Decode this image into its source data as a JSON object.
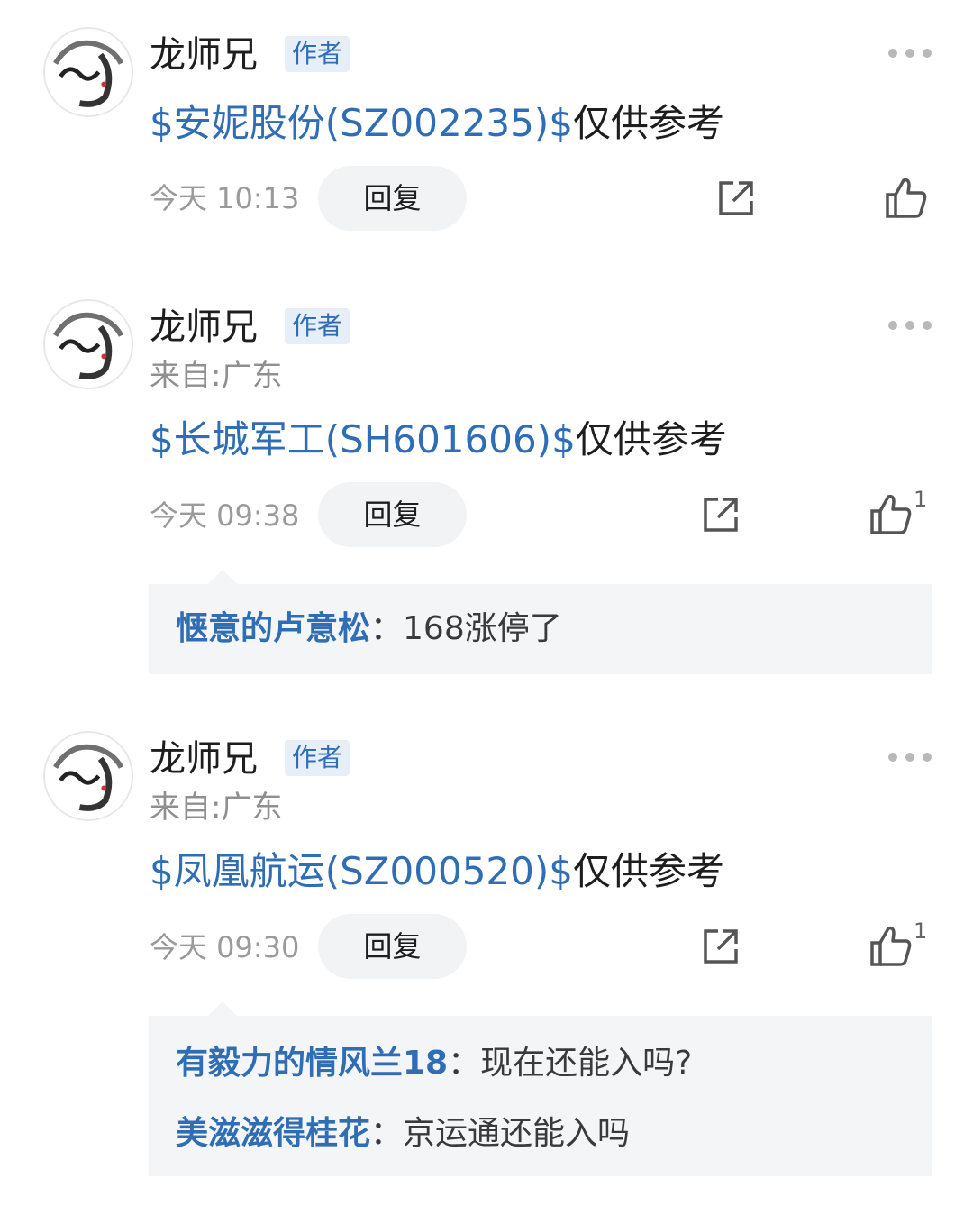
{
  "posts": [
    {
      "author": "龙师兄",
      "badge": "作者",
      "location": "",
      "stock": "$安妮股份(SZ002235)$",
      "text": "仅供参考",
      "time": "今天 10:13",
      "reply_label": "回复",
      "likes": ""
    },
    {
      "author": "龙师兄",
      "badge": "作者",
      "location": "来自:广东",
      "stock": "$长城军工(SH601606)$",
      "text": "仅供参考",
      "time": "今天 09:38",
      "reply_label": "回复",
      "likes": "1",
      "comments": [
        {
          "user": "惬意的卢意松",
          "text": "：168涨停了"
        }
      ]
    },
    {
      "author": "龙师兄",
      "badge": "作者",
      "location": "来自:广东",
      "stock": "$凤凰航运(SZ000520)$",
      "text": "仅供参考",
      "time": "今天 09:30",
      "reply_label": "回复",
      "likes": "1",
      "comments": [
        {
          "user": "有毅力的情风兰18",
          "text": "：现在还能入吗?"
        },
        {
          "user": "美滋滋得桂花",
          "text": "：京运通还能入吗"
        }
      ]
    }
  ],
  "icons": {
    "avatar": "calligraphy-avatar-icon",
    "more": "more-dots-icon",
    "share": "share-icon",
    "like": "thumbs-up-icon"
  },
  "colors": {
    "link": "#2f6db5",
    "badge_bg": "#e6eef8",
    "reply_bg": "#f2f3f5",
    "comment_bg": "#f4f5f7"
  }
}
